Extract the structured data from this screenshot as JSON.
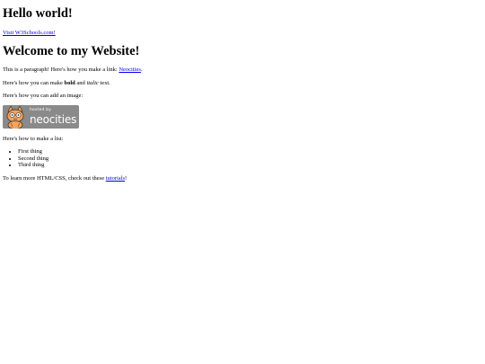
{
  "heading1": "Hello world!",
  "w3schools_link": "Visit W3Schools.com!",
  "heading2": "Welcome to my Website!",
  "para_link": {
    "before": "This is a paragraph! Here's how you make a link: ",
    "link": "Neocities",
    "after": "."
  },
  "para_bold": {
    "before": "Here's how you can make ",
    "bold": "bold",
    "middle": " and ",
    "italic": "italic",
    "after": " text."
  },
  "para_image": "Here's how you can add an image:",
  "badge": {
    "small_text": "hosted by",
    "big_text": "neocities",
    "icon": "neocities-cat-icon",
    "background": "#8a8a8a"
  },
  "para_list": "Here's how to make a list:",
  "list_items": [
    "First thing",
    "Second thing",
    "Third thing"
  ],
  "para_tutorials": {
    "before": "To learn more HTML/CSS, check out these ",
    "link": "tutorials",
    "after": "!"
  },
  "colors": {
    "link": "#0000ee",
    "text": "#000000",
    "background": "#ffffff"
  }
}
